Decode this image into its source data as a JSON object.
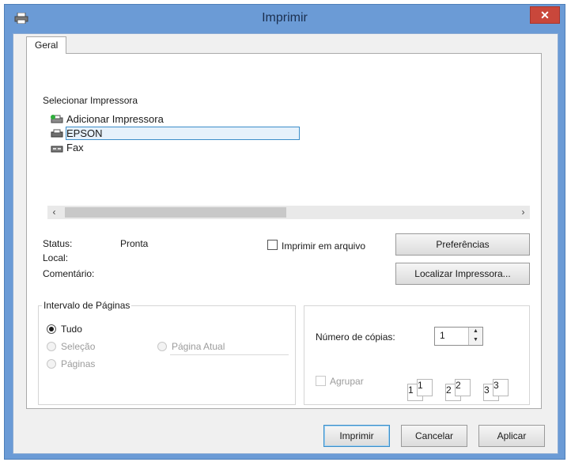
{
  "window": {
    "title": "Imprimir",
    "close_glyph": "✕",
    "icon": "printer-icon"
  },
  "tabs": [
    {
      "label": "Geral"
    }
  ],
  "select_printer": {
    "label": "Selecionar Impressora",
    "items": [
      {
        "label": "Adicionar Impressora",
        "icon": "add-printer-icon"
      },
      {
        "label": "EPSON",
        "icon": "printer-icon",
        "selected": true
      },
      {
        "label": "Fax",
        "icon": "fax-icon"
      }
    ],
    "scroll_left": "‹",
    "scroll_right": "›"
  },
  "status": {
    "status_label": "Status:",
    "status_value": "Pronta",
    "local_label": "Local:",
    "comment_label": "Comentário:",
    "print_to_file": "Imprimir em arquivo",
    "preferences_button": "Preferências",
    "find_printer_button": "Localizar Impressora..."
  },
  "page_range": {
    "label": "Intervalo de Páginas",
    "all": "Tudo",
    "selection": "Seleção",
    "current_page": "Página Atual",
    "pages": "Páginas"
  },
  "copies": {
    "label": "Número de cópias:",
    "value": "1",
    "collate": "Agrupar",
    "collate_digits": [
      "1",
      "1",
      "2",
      "2",
      "3",
      "3"
    ]
  },
  "footer": {
    "print_button": "Imprimir",
    "cancel_button": "Cancelar",
    "apply_button": "Aplicar"
  },
  "colors": {
    "frame": "#6b9bd6",
    "close": "#c9473b",
    "selection_outline": "#3c8ec9"
  }
}
